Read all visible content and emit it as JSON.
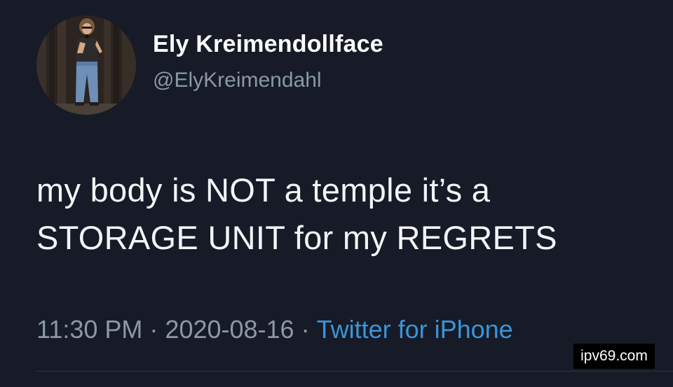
{
  "author": {
    "display_name": "Ely Kreimendollface",
    "handle": "@ElyKreimendahl",
    "avatar_icon": "profile-photo"
  },
  "tweet": {
    "lines": [
      "my body is NOT a temple it’s a",
      "STORAGE UNIT for my REGRETS"
    ]
  },
  "meta": {
    "time": "11:30 PM",
    "separator": "·",
    "date": "2020-08-16",
    "source": "Twitter for iPhone"
  },
  "watermark": {
    "text": "ipv69.com"
  },
  "colors": {
    "background": "#161b27",
    "secondary_text": "#8b98a5",
    "link": "#3b94d9"
  }
}
